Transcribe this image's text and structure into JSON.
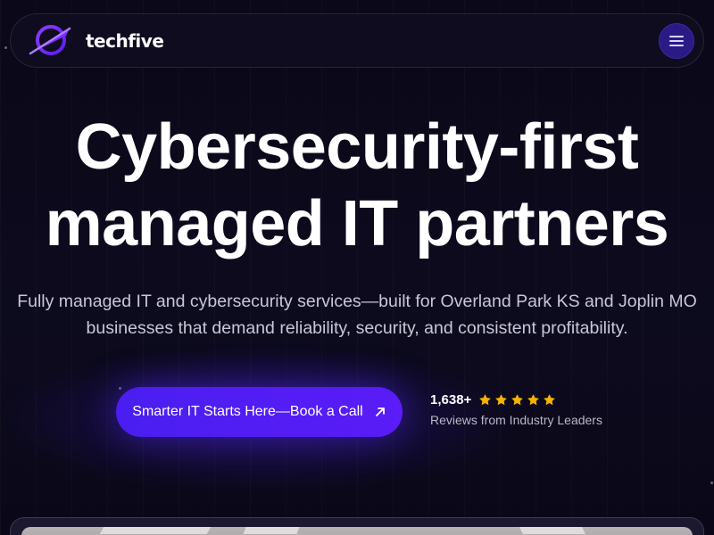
{
  "brand": {
    "name": "techfive",
    "accent": "#5a1cf8",
    "accent_dark": "#2a1a86"
  },
  "nav": {
    "menu_icon": "hamburger-menu-icon"
  },
  "hero": {
    "title_line1": "Cybersecurity-first",
    "title_line2": "managed IT partners",
    "subtitle_line1": "Fully managed IT and cybersecurity services—built for Overland Park KS and Joplin MO",
    "subtitle_line2": "businesses that demand reliability, security, and consistent profitability."
  },
  "cta": {
    "label": "Smarter IT Starts Here—Book a Call",
    "icon": "arrow-up-right-icon"
  },
  "reviews": {
    "count": "1,638+",
    "rating_stars": 5,
    "label": "Reviews from Industry Leaders",
    "star_color": "#f5b301"
  }
}
